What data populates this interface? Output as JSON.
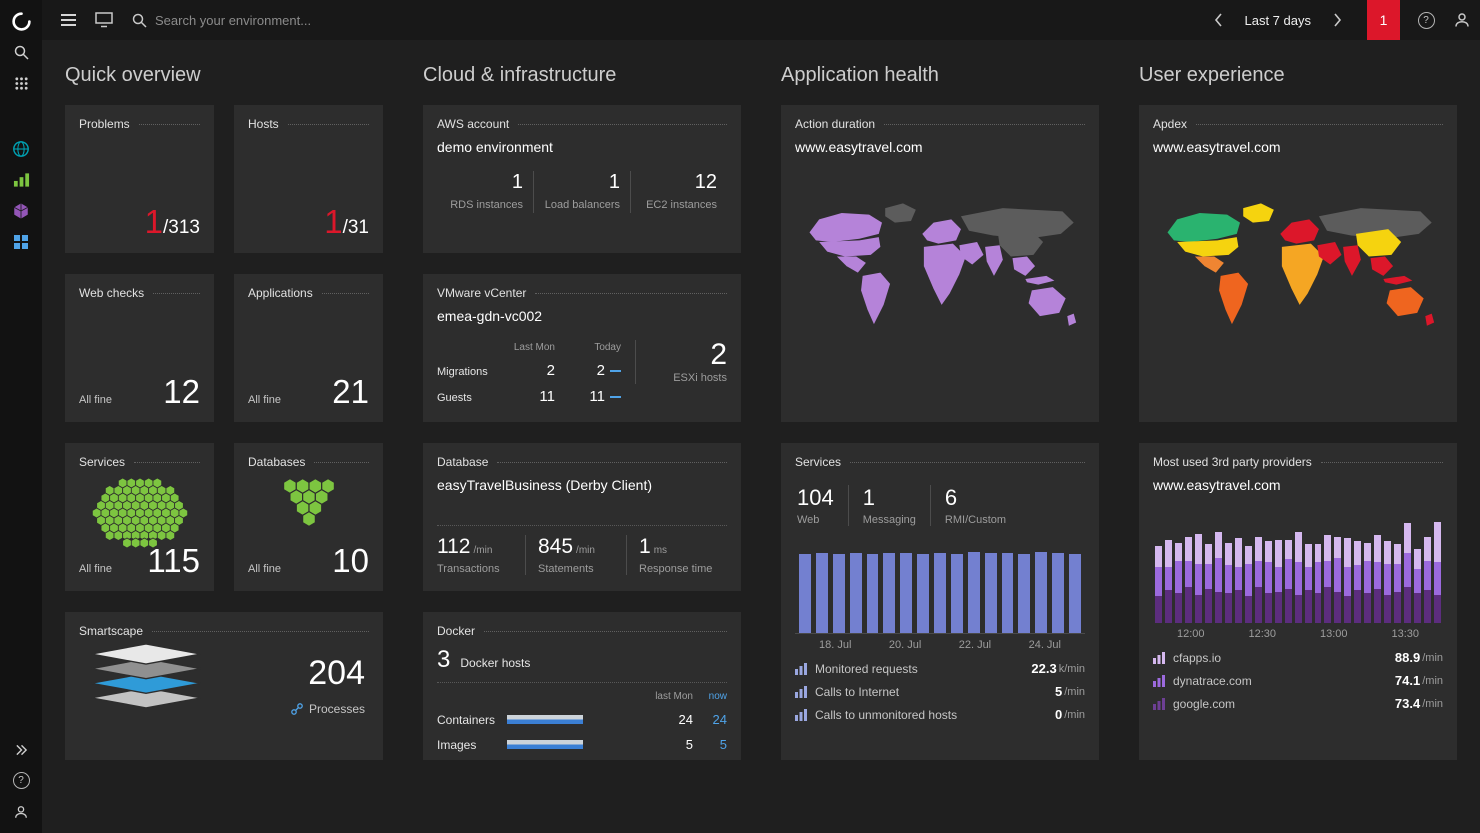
{
  "colors": {
    "accent_red": "#dc172a",
    "good_green": "#7dc540",
    "link_blue": "#4fa3e8",
    "bar_blue": "#7380d0",
    "map_purple": "#b583d9",
    "map_gray": "#5c5c5c"
  },
  "topbar": {
    "search_placeholder": "Search your environment...",
    "time_range": "Last 7 days",
    "notification_count": "1",
    "icons": [
      "menu-icon",
      "dashboard-icon",
      "search-icon",
      "chevron-left-icon",
      "chevron-right-icon",
      "problems-badge",
      "help-icon",
      "user-icon"
    ]
  },
  "sidebar": {
    "icons": [
      "dynatrace-logo",
      "search-icon",
      "apps-grid-icon",
      "globe-icon",
      "chart-icon",
      "cube-icon",
      "hosts-icon",
      "expand-icon",
      "help-icon",
      "user-icon"
    ]
  },
  "quick_overview": {
    "header": "Quick overview",
    "problems": {
      "title": "Problems",
      "affected": "1",
      "total": "/313"
    },
    "hosts": {
      "title": "Hosts",
      "affected": "1",
      "total": "/31"
    },
    "web_checks": {
      "title": "Web checks",
      "status": "All fine",
      "count": "12"
    },
    "applications": {
      "title": "Applications",
      "status": "All fine",
      "count": "21"
    },
    "services": {
      "title": "Services",
      "status": "All fine",
      "count": "115"
    },
    "databases": {
      "title": "Databases",
      "status": "All fine",
      "count": "10"
    },
    "smartscape": {
      "title": "Smartscape",
      "count": "204",
      "label": "Processes"
    }
  },
  "cloud": {
    "header": "Cloud & infrastructure",
    "aws": {
      "title": "AWS account",
      "subtitle": "demo environment",
      "stats": [
        {
          "value": "1",
          "label": "RDS instances"
        },
        {
          "value": "1",
          "label": "Load balancers"
        },
        {
          "value": "12",
          "label": "EC2 instances"
        }
      ]
    },
    "vmware": {
      "title": "VMware vCenter",
      "subtitle": "emea-gdn-vc002",
      "col_last_mon": "Last Mon",
      "col_today": "Today",
      "rows": [
        {
          "label": "Migrations",
          "last_mon": "2",
          "today": "2"
        },
        {
          "label": "Guests",
          "last_mon": "11",
          "today": "11"
        }
      ],
      "esxi_value": "2",
      "esxi_label": "ESXi hosts"
    },
    "database": {
      "title": "Database",
      "subtitle": "easyTravelBusiness (Derby Client)",
      "stats": [
        {
          "value": "112",
          "unit": "/min",
          "label": "Transactions"
        },
        {
          "value": "845",
          "unit": "/min",
          "label": "Statements"
        },
        {
          "value": "1",
          "unit": "ms",
          "label": "Response time"
        }
      ]
    },
    "docker": {
      "title": "Docker",
      "hosts_value": "3",
      "hosts_label": "Docker hosts",
      "col_last_mon": "last Mon",
      "col_now": "now",
      "rows": [
        {
          "label": "Containers",
          "last_mon": "24",
          "now": "24"
        },
        {
          "label": "Images",
          "last_mon": "5",
          "now": "5"
        }
      ]
    }
  },
  "app_health": {
    "header": "Application health",
    "action_duration": {
      "title": "Action duration",
      "subtitle": "www.easytravel.com"
    },
    "services": {
      "title": "Services",
      "stats": [
        {
          "value": "104",
          "label": "Web"
        },
        {
          "value": "1",
          "label": "Messaging"
        },
        {
          "value": "6",
          "label": "RMI/Custom"
        }
      ],
      "legend": [
        {
          "label": "Monitored requests",
          "value": "22.3",
          "unit": "k/min",
          "icon_color": "#9aa7e0"
        },
        {
          "label": "Calls to Internet",
          "value": "5",
          "unit": "/min",
          "icon_color": "#9aa7e0"
        },
        {
          "label": "Calls to unmonitored hosts",
          "value": "0",
          "unit": "/min",
          "icon_color": "#9aa7e0"
        }
      ]
    }
  },
  "user_experience": {
    "header": "User experience",
    "apdex": {
      "title": "Apdex",
      "subtitle": "www.easytravel.com"
    },
    "providers": {
      "title": "Most used 3rd party providers",
      "subtitle": "www.easytravel.com",
      "legend": [
        {
          "label": "cfapps.io",
          "value": "88.9",
          "unit": "/min",
          "icon_color": "#d5b8ef"
        },
        {
          "label": "dynatrace.com",
          "value": "74.1",
          "unit": "/min",
          "icon_color": "#9c6ade"
        },
        {
          "label": "google.com",
          "value": "73.4",
          "unit": "/min",
          "icon_color": "#6d3f94"
        }
      ]
    }
  },
  "hex_clusters": {
    "services": {
      "rows": [
        5,
        8,
        9,
        10,
        11,
        10,
        9,
        8,
        4
      ],
      "color": "#7dc540"
    },
    "databases": {
      "rows": [
        4,
        3,
        2,
        1
      ],
      "color": "#7dc540"
    }
  },
  "smartscape_layers": {
    "colors": [
      "#e8e8e8",
      "#909090",
      "#2f9bd8",
      "#c2c2c2"
    ]
  },
  "maps": {
    "action_duration": {
      "greenland": "#5c5c5c",
      "canada": "#b583d9",
      "usa": "#b583d9",
      "mexico": "#b583d9",
      "south_america": "#b583d9",
      "europe": "#b583d9",
      "africa": "#b583d9",
      "russia": "#5c5c5c",
      "middle_east": "#b583d9",
      "india": "#b583d9",
      "east_asia": "#5c5c5c",
      "se_asia": "#b583d9",
      "indonesia": "#b583d9",
      "australia": "#b583d9",
      "new_zealand": "#b583d9"
    },
    "apdex": {
      "greenland": "#f5d30f",
      "canada": "#2ab36f",
      "usa": "#f5d30f",
      "mexico": "#ef8532",
      "south_america": "#ef651f",
      "europe": "#dc172a",
      "africa": "#f5a623",
      "russia": "#5c5c5c",
      "middle_east": "#dc172a",
      "india": "#dc172a",
      "east_asia": "#f5d30f",
      "se_asia": "#dc172a",
      "indonesia": "#dc172a",
      "australia": "#ef651f",
      "new_zealand": "#dc172a"
    }
  },
  "chart_data": [
    {
      "type": "bar",
      "title": "Services — monitored requests",
      "x_ticks": [
        "18. Jul",
        "20. Jul",
        "22. Jul",
        "24. Jul"
      ],
      "ylabel": "requests (k/min)",
      "ylim": [
        0,
        25
      ],
      "max": 25,
      "color": "#7380d0",
      "values": [
        21.6,
        21.9,
        21.7,
        22,
        21.8,
        22.1,
        21.9,
        21.7,
        22,
        21.8,
        22.2,
        21.9,
        22,
        21.7,
        22.3,
        22,
        21.8
      ]
    },
    {
      "type": "bar",
      "stacked": true,
      "title": "Most used 3rd party providers — requests/min",
      "x_ticks": [
        "12:00",
        "12:30",
        "13:00",
        "13:30"
      ],
      "ylim": [
        0,
        70
      ],
      "max": 70,
      "legend_position": "below",
      "series": [
        {
          "name": "google.com",
          "color": "#5c2d7e",
          "values": [
            18,
            22,
            20,
            24,
            19,
            23,
            21,
            20,
            22,
            18,
            24,
            20,
            21,
            23,
            19,
            22,
            20,
            24,
            21,
            18,
            22,
            20,
            23,
            19,
            21,
            24,
            20,
            22,
            19
          ]
        },
        {
          "name": "dynatrace.com",
          "color": "#9c6ade",
          "values": [
            20,
            16,
            22,
            18,
            21,
            17,
            23,
            19,
            16,
            22,
            18,
            21,
            17,
            20,
            22,
            16,
            21,
            18,
            23,
            20,
            17,
            22,
            18,
            21,
            19,
            23,
            16,
            20,
            22
          ]
        },
        {
          "name": "cfapps.io",
          "color": "#d5b8ef",
          "values": [
            14,
            18,
            12,
            16,
            20,
            13,
            17,
            15,
            19,
            12,
            16,
            14,
            18,
            13,
            20,
            15,
            12,
            17,
            14,
            19,
            16,
            12,
            18,
            15,
            13,
            20,
            14,
            16,
            27
          ]
        }
      ]
    }
  ]
}
